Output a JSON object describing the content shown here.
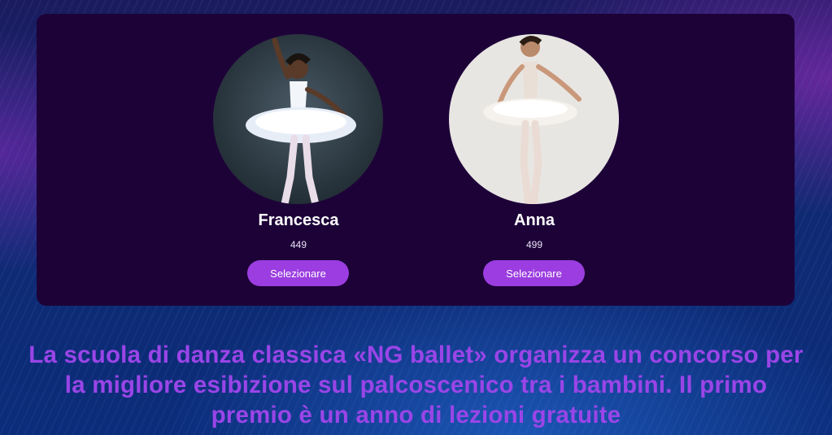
{
  "dancers": [
    {
      "name": "Francesca",
      "votes": "449",
      "button_label": "Selezionare"
    },
    {
      "name": "Anna",
      "votes": "499",
      "button_label": "Selezionare"
    }
  ],
  "headline": "La scuola di danza classica «NG ballet» organizza un concorso per la migliore esibizione sul palcoscenico tra i bambini. Il primo premio è un anno di lezioni gratuite",
  "colors": {
    "card_background": "#1d0238",
    "button": "#9b3de0",
    "headline": "#9a45e8"
  }
}
